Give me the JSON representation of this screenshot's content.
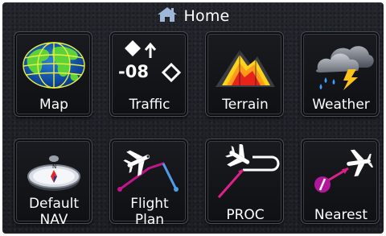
{
  "header": {
    "title": "Home",
    "icon": "home-icon"
  },
  "tiles": [
    {
      "label": "Map",
      "icon": "globe-map-icon"
    },
    {
      "label": "Traffic",
      "icon": "traffic-icon",
      "altitude_text": "-08"
    },
    {
      "label": "Terrain",
      "icon": "terrain-icon"
    },
    {
      "label": "Weather",
      "icon": "weather-storm-icon"
    },
    {
      "label_line1": "Default",
      "label_line2": "NAV",
      "icon": "compass-icon"
    },
    {
      "label_line1": "Flight",
      "label_line2": "Plan",
      "icon": "flight-plan-icon"
    },
    {
      "label": "PROC",
      "icon": "procedure-icon"
    },
    {
      "label": "Nearest",
      "icon": "nearest-airport-icon"
    }
  ]
}
